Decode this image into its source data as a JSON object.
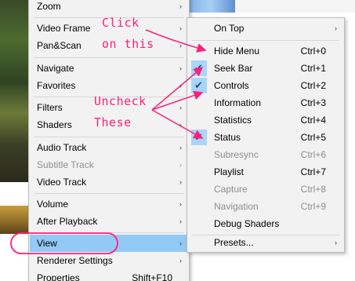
{
  "main_menu": {
    "items": [
      {
        "label": "Zoom",
        "arrow": "›",
        "disabled": false
      },
      {
        "label": "Video Frame",
        "arrow": "›",
        "disabled": false
      },
      {
        "label": "Pan&Scan",
        "arrow": "›",
        "disabled": false
      },
      {
        "label": "Navigate",
        "arrow": "›",
        "disabled": false
      },
      {
        "label": "Favorites",
        "arrow": "›",
        "disabled": false
      },
      {
        "label": "Filters",
        "arrow": "›",
        "disabled": false
      },
      {
        "label": "Shaders",
        "arrow": "›",
        "disabled": false
      },
      {
        "label": "Audio Track",
        "arrow": "›",
        "disabled": false
      },
      {
        "label": "Subtitle Track",
        "arrow": "›",
        "disabled": true
      },
      {
        "label": "Video Track",
        "arrow": "›",
        "disabled": false
      },
      {
        "label": "Volume",
        "arrow": "›",
        "disabled": false
      },
      {
        "label": "After Playback",
        "arrow": "›",
        "disabled": false
      },
      {
        "label": "View",
        "arrow": "›",
        "disabled": false
      },
      {
        "label": "Renderer Settings",
        "arrow": "›",
        "disabled": false
      },
      {
        "label": "Properties",
        "shortcut": "Shift+F10",
        "disabled": false
      }
    ]
  },
  "view_submenu": {
    "items": [
      {
        "label": "On Top",
        "arrow": "›",
        "checked": false,
        "disabled": false
      },
      {
        "label": "Hide Menu",
        "shortcut": "Ctrl+0",
        "checked": false,
        "disabled": false
      },
      {
        "label": "Seek Bar",
        "shortcut": "Ctrl+1",
        "checked": true,
        "disabled": false
      },
      {
        "label": "Controls",
        "shortcut": "Ctrl+2",
        "checked": true,
        "disabled": false
      },
      {
        "label": "Information",
        "shortcut": "Ctrl+3",
        "checked": false,
        "disabled": false
      },
      {
        "label": "Statistics",
        "shortcut": "Ctrl+4",
        "checked": false,
        "disabled": false
      },
      {
        "label": "Status",
        "shortcut": "Ctrl+5",
        "checked": true,
        "disabled": false
      },
      {
        "label": "Subresync",
        "shortcut": "Ctrl+6",
        "checked": false,
        "disabled": true
      },
      {
        "label": "Playlist",
        "shortcut": "Ctrl+7",
        "checked": false,
        "disabled": false
      },
      {
        "label": "Capture",
        "shortcut": "Ctrl+8",
        "checked": false,
        "disabled": true
      },
      {
        "label": "Navigation",
        "shortcut": "Ctrl+9",
        "checked": false,
        "disabled": true
      },
      {
        "label": "Debug Shaders",
        "checked": false,
        "disabled": false
      },
      {
        "label": "Presets...",
        "arrow": "›",
        "checked": false,
        "disabled": false
      }
    ]
  },
  "annotations": {
    "click_line1": "Click",
    "click_line2": "on this",
    "uncheck_line1": "Uncheck",
    "uncheck_line2": "These",
    "color": "#ff1f7a"
  },
  "colors": {
    "menu_bg": "#f2f2f2",
    "highlight": "#93c9f5",
    "check_bg": "#a9d6f7",
    "disabled_text": "#8f8f8f"
  }
}
